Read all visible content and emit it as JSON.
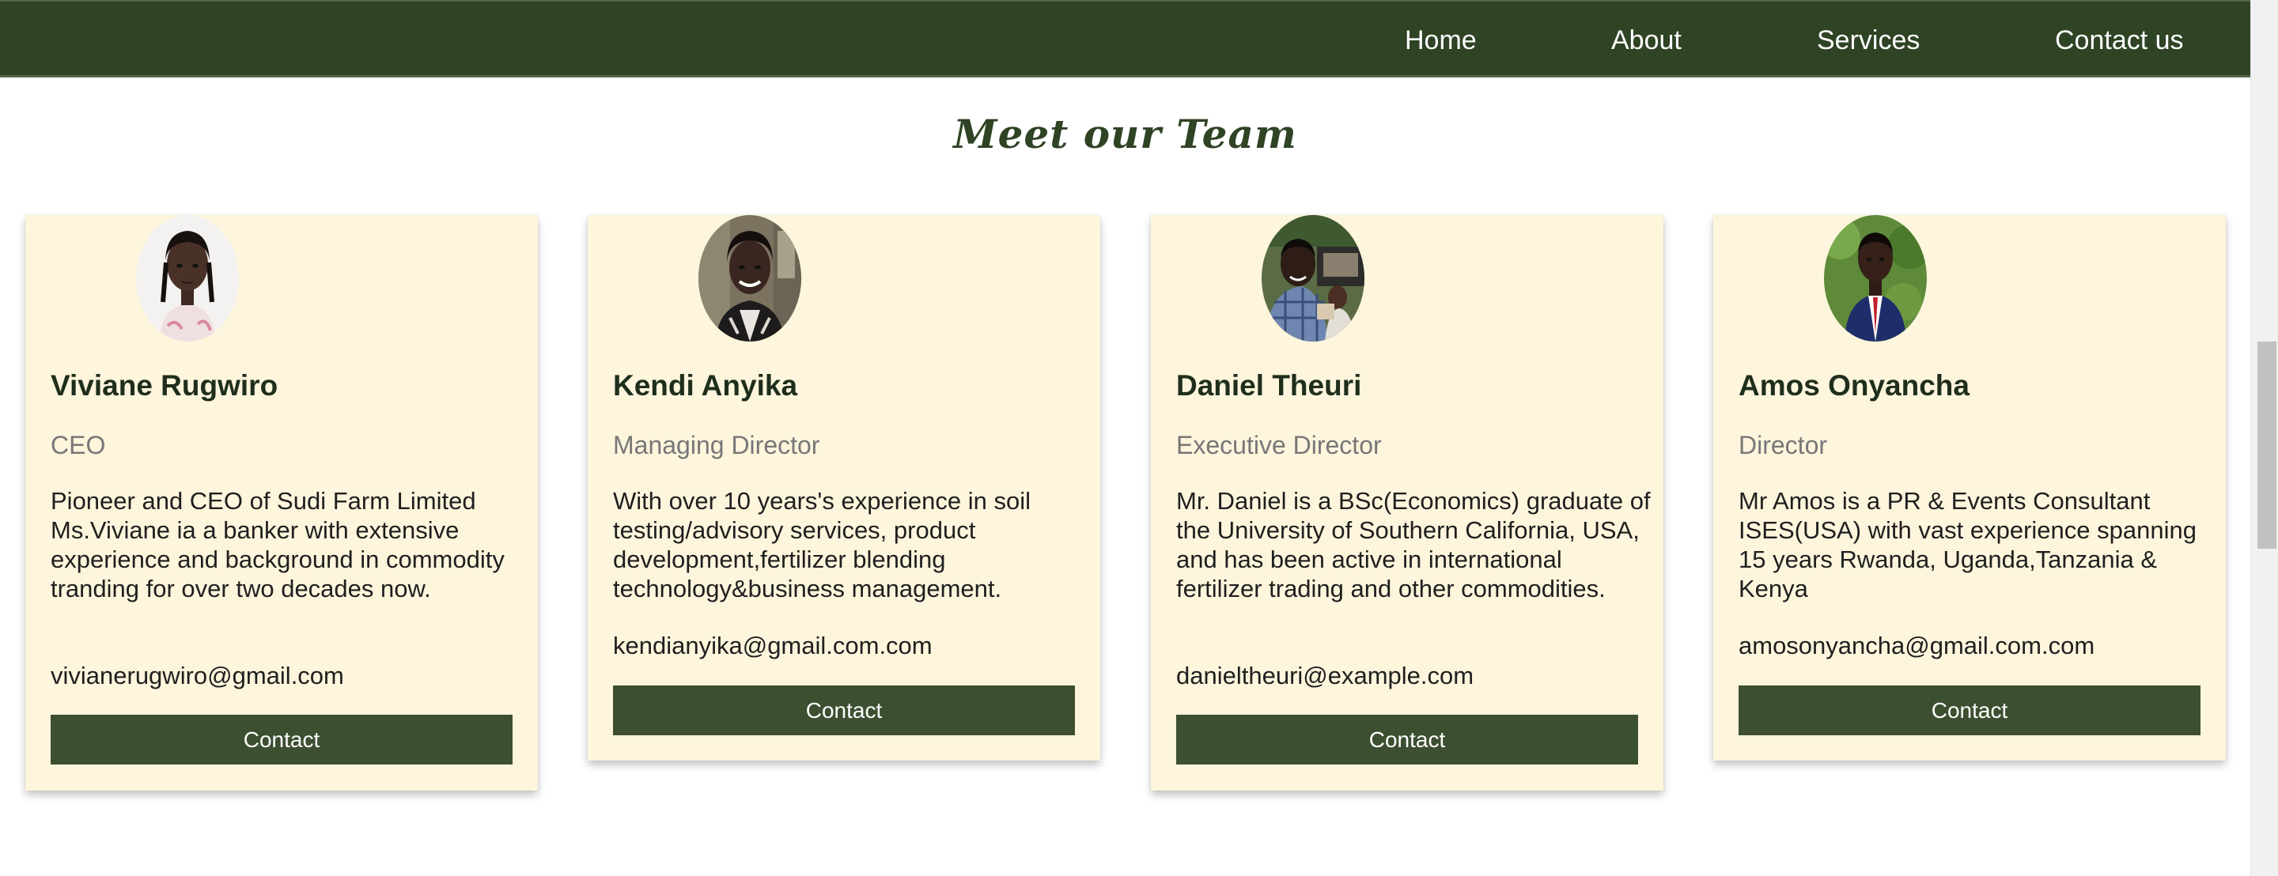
{
  "nav": {
    "links": [
      "Home",
      "About",
      "Services",
      "Contact us"
    ]
  },
  "section": {
    "title": "Meet our Team"
  },
  "team": [
    {
      "name": "Viviane Rugwiro",
      "role": "CEO",
      "bio": "Pioneer and CEO of Sudi Farm Limited Ms.Viviane ia a banker with extensive experience and background in commodity tranding for over two decades now.",
      "email": "vivianerugwiro@gmail.com",
      "button": "Contact"
    },
    {
      "name": "Kendi Anyika",
      "role": "Managing Director",
      "bio": "With over 10 years's experience in soil testing/advisory services, product development,fertilizer blending technology&business management.",
      "email": "kendianyika@gmail.com.com",
      "button": "Contact"
    },
    {
      "name": "Daniel Theuri",
      "role": "Executive Director",
      "bio": "Mr. Daniel is a BSc(Economics) graduate of the University of Southern California, USA, and has been active in international fertilizer trading and other commodities.",
      "email": "danieltheuri@example.com",
      "button": "Contact"
    },
    {
      "name": "Amos Onyancha",
      "role": "Director",
      "bio": "Mr Amos is a PR & Events Consultant ISES(USA) with vast experience spanning 15 years Rwanda, Uganda,Tanzania & Kenya",
      "email": "amosonyancha@gmail.com.com",
      "button": "Contact"
    }
  ],
  "colors": {
    "nav_bg": "#2f4325",
    "card_bg": "#fdf5dc",
    "button_bg": "#3d4f31",
    "title": "#2f4325"
  }
}
